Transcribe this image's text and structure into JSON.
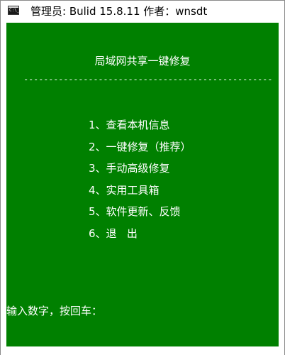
{
  "window": {
    "title": "管理员: Bulid 15.8.11  作者：wnsdt",
    "icon": "console-icon",
    "icon_text": "C:\\_",
    "controls": "—  □  ✕"
  },
  "console": {
    "background_color": "#008000",
    "text_color": "#ffffff",
    "heading": "局域网共享一键修复",
    "divider": "--------------------------------------------------",
    "menu": [
      {
        "label": "1、查看本机信息"
      },
      {
        "label": "2、一键修复（推荐）"
      },
      {
        "label": "3、手动高级修复"
      },
      {
        "label": "4、实用工具箱"
      },
      {
        "label": "5、软件更新、反馈"
      },
      {
        "label": "6、退   出"
      }
    ],
    "prompt": "输入数字，按回车："
  }
}
